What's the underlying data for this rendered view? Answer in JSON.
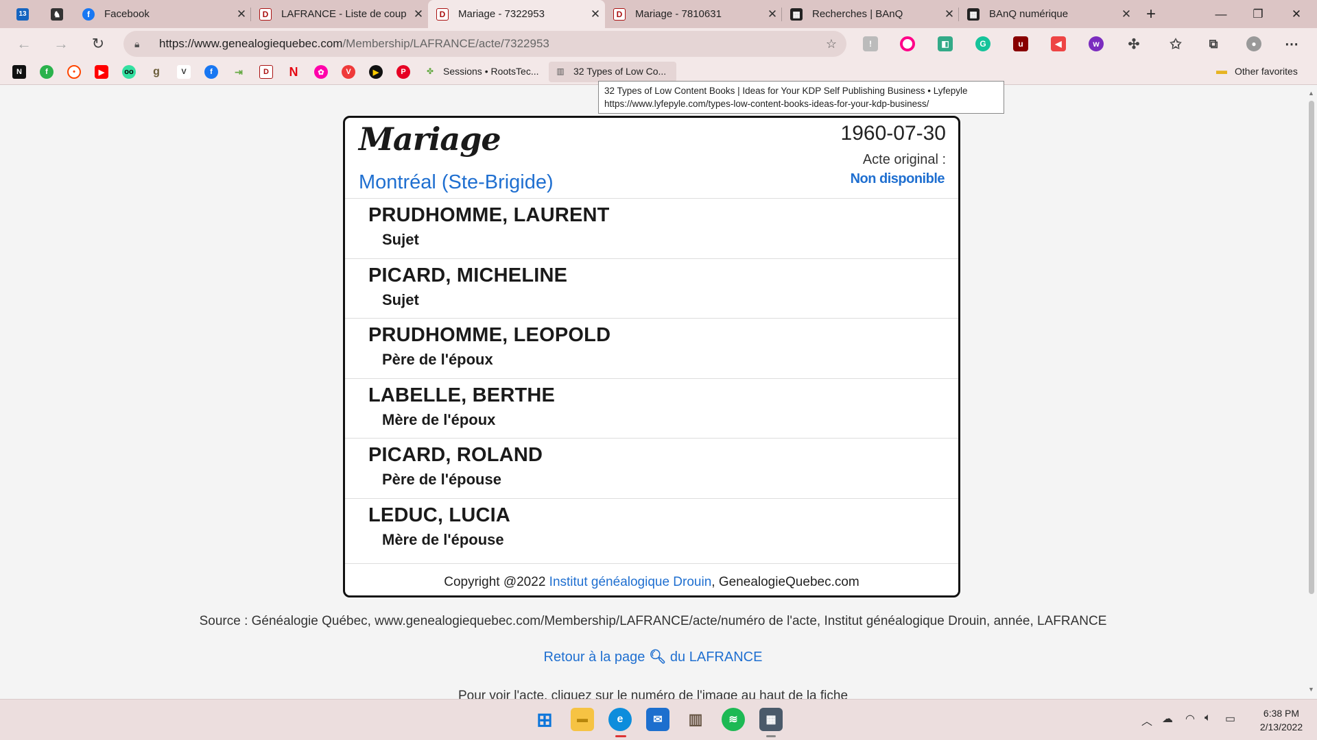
{
  "tabs": [
    {
      "title": "",
      "icon": "calendar-icon",
      "pinned": true
    },
    {
      "title": "",
      "icon": "person-icon",
      "pinned": true
    },
    {
      "title": "Facebook",
      "icon": "facebook-icon"
    },
    {
      "title": "LAFRANCE - Liste de coup",
      "icon": "drouin-icon"
    },
    {
      "title": "Mariage - 7322953",
      "icon": "drouin-icon",
      "active": true
    },
    {
      "title": "Mariage - 7810631",
      "icon": "drouin-icon"
    },
    {
      "title": "Recherches | BAnQ",
      "icon": "banq-icon"
    },
    {
      "title": "BAnQ numérique",
      "icon": "banq-icon"
    }
  ],
  "new_tab_label": "+",
  "address": {
    "url_host": "https://www.genealogiequebec.com",
    "url_path": "/Membership/LAFRANCE/acte/7322953"
  },
  "favorites": {
    "items": [
      "notion",
      "feedly",
      "reddit",
      "youtube",
      "tripadvisor",
      "goodreads",
      "vivino",
      "facebook",
      "redirect",
      "drouin",
      "netflix",
      "flickr",
      "vivaldi",
      "play",
      "pinterest"
    ],
    "sessions_label": "Sessions • RootsTec...",
    "types_label": "32 Types of Low Co...",
    "other_label": "Other favorites"
  },
  "tooltip": {
    "line1": "32 Types of Low Content Books | Ideas for Your KDP Self Publishing Business • Lyfepyle",
    "line2": "https://www.lyfepyle.com/types-low-content-books-ideas-for-your-kdp-business/"
  },
  "record": {
    "title": "Mariage",
    "date": "1960-07-30",
    "original_label": "Acte original :",
    "original_value": "Non disponible",
    "place": "Montréal (Ste-Brigide)",
    "people": [
      {
        "name": "PRUDHOMME, LAURENT",
        "role": "Sujet"
      },
      {
        "name": "PICARD, MICHELINE",
        "role": "Sujet"
      },
      {
        "name": "PRUDHOMME, LEOPOLD",
        "role": "Père de l'époux"
      },
      {
        "name": "LABELLE, BERTHE",
        "role": "Mère de l'époux"
      },
      {
        "name": "PICARD, ROLAND",
        "role": "Père de l'épouse"
      },
      {
        "name": "LEDUC, LUCIA",
        "role": "Mère de l'épouse"
      }
    ],
    "footer_prefix": "Copyright @2022 ",
    "footer_link": "Institut généalogique Drouin",
    "footer_suffix": ", GenealogieQuebec.com"
  },
  "page": {
    "source": "Source : Généalogie Québec, www.genealogiequebec.com/Membership/LAFRANCE/acte/numéro de l'acte, Institut généalogique Drouin, année, LAFRANCE",
    "return_prefix": "Retour à la page ",
    "return_suffix": " du LAFRANCE",
    "cut_text": "Pour voir l'acte, cliquez sur le numéro de l'image au haut de la fiche"
  },
  "taskbar": {
    "apps": [
      "windows-start",
      "file-explorer",
      "edge",
      "mail",
      "books",
      "spotify",
      "calculator"
    ],
    "time": "6:38 PM",
    "date": "2/13/2022"
  },
  "colors": {
    "link": "#1f6fd0",
    "chrome_bg": "#dcc5c5",
    "toolbar_bg": "#f3e8e8"
  }
}
